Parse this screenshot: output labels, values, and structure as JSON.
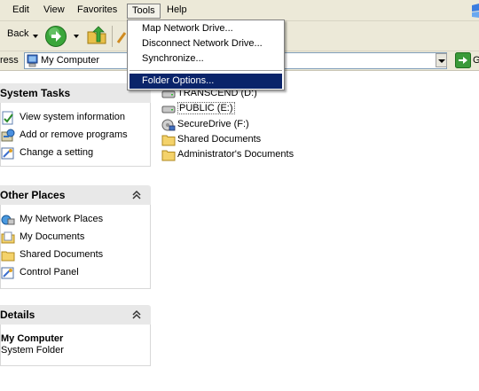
{
  "menubar": {
    "items": [
      {
        "label": "Edit"
      },
      {
        "label": "View"
      },
      {
        "label": "Favorites"
      },
      {
        "label": "Tools"
      },
      {
        "label": "Help"
      }
    ],
    "open_menu": "Tools"
  },
  "toolbar": {
    "back_label": "Back",
    "icons": [
      "back-arrow-icon",
      "forward-arrow-icon",
      "up-folder-icon",
      "search-icon"
    ]
  },
  "address": {
    "label": "ress",
    "value": "My Computer",
    "go_label": "G"
  },
  "tools_menu": {
    "items": [
      {
        "label": "Map Network Drive..."
      },
      {
        "label": "Disconnect Network Drive..."
      },
      {
        "label": "Synchronize..."
      },
      {
        "label": "Folder Options...",
        "selected": true
      }
    ]
  },
  "system_tasks": {
    "title": "System Tasks",
    "items": [
      {
        "label": "View system information",
        "icon": "system-info-icon"
      },
      {
        "label": "Add or remove programs",
        "icon": "add-remove-programs-icon"
      },
      {
        "label": "Change a setting",
        "icon": "control-panel-setting-icon"
      }
    ]
  },
  "other_places": {
    "title": "Other Places",
    "items": [
      {
        "label": "My Network Places",
        "icon": "network-places-icon"
      },
      {
        "label": "My Documents",
        "icon": "my-documents-icon"
      },
      {
        "label": "Shared Documents",
        "icon": "folder-icon"
      },
      {
        "label": "Control Panel",
        "icon": "control-panel-icon"
      }
    ]
  },
  "details": {
    "title": "Details",
    "name": "My Computer",
    "type": "System Folder"
  },
  "files": [
    {
      "label": "TRANSCEND (D:)",
      "icon": "drive-icon"
    },
    {
      "label": "PUBLIC (E:)",
      "icon": "drive-icon"
    },
    {
      "label": "SecureDrive (F:)",
      "icon": "secure-drive-icon"
    },
    {
      "label": "Shared Documents",
      "icon": "folder-icon"
    },
    {
      "label": "Administrator's Documents",
      "icon": "folder-icon"
    }
  ],
  "colors": {
    "menu_bg": "#ece9d8",
    "selection": "#0a246a",
    "panel_header": "#e8e8e8",
    "folder": "#f4d26a",
    "go_green": "#3a9a3a"
  }
}
